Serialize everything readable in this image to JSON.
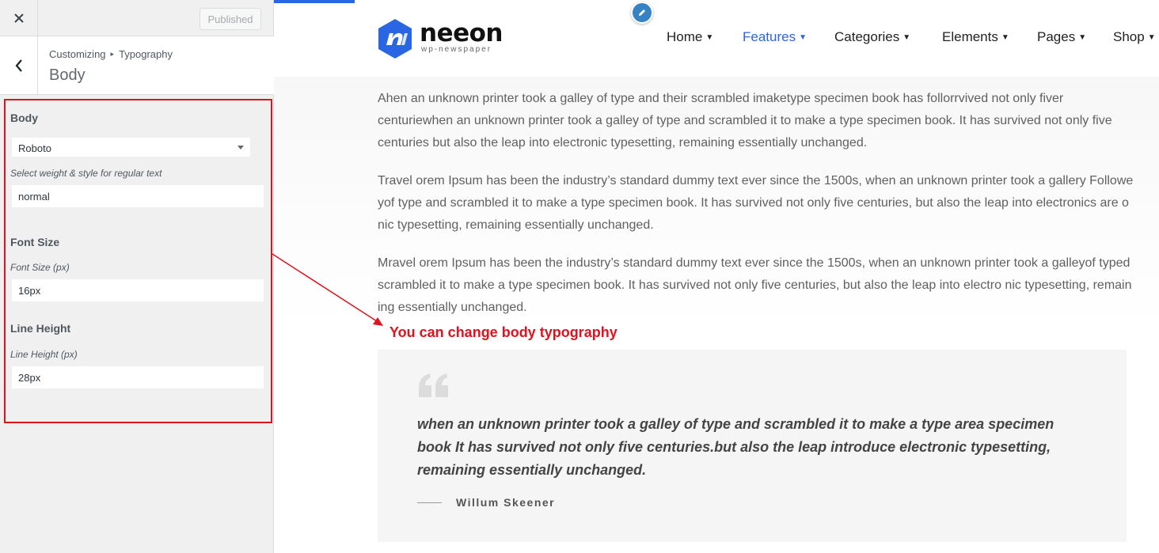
{
  "sidebar": {
    "close_label": "×",
    "published_label": "Published",
    "breadcrumb": {
      "root": "Customizing",
      "parent": "Typography"
    },
    "section_title": "Body",
    "controls": {
      "heading": "Body",
      "font_family": "Roboto",
      "weight_desc": "Select weight & style for regular text",
      "weight_value": "normal",
      "font_size_heading": "Font Size",
      "font_size_desc": "Font Size (px)",
      "font_size_value": "16px",
      "line_height_heading": "Line Height",
      "line_height_desc": "Line Height (px)",
      "line_height_value": "28px"
    }
  },
  "site": {
    "logo": {
      "name": "neeon",
      "tagline": "wp-newspaper"
    },
    "nav": [
      {
        "label": "Home"
      },
      {
        "label": "Features"
      },
      {
        "label": "Categories"
      },
      {
        "label": "Elements"
      },
      {
        "label": "Pages"
      },
      {
        "label": "Shop"
      }
    ],
    "active_nav": "Features",
    "paragraphs": [
      "Ahen an unknown printer took a galley of type and their scrambled imaketype specimen book has follorrvived not only fiver centuriewhen an unknown printer took a galley of type and scrambled it to make a type specimen book. It has survived not only five centuries but also the leap into electronic typesetting, remaining essentially unchanged.",
      "Travel orem Ipsum has been the industry’s standard dummy text ever since the 1500s, when an unknown printer took a gallery Followe yof type and scrambled it to make a type specimen book. It has survived not only five centuries, but also the leap into electronics are o nic typesetting, remaining essentially unchanged.",
      "Mravel orem Ipsum has been the industry’s standard dummy text ever since the 1500s, when an unknown printer took a galleyof typed scrambled it to make a type specimen book. It has survived not only five centuries, but also the leap into electro nic typesetting, remain ing essentially unchanged."
    ],
    "annotation": "You can change body typography",
    "quote": {
      "text": "when an unknown printer took a galley of type and scrambled it to make a type area specimen book It has survived not only five centuries.but also the leap introduce electronic typesetting, remaining essentially unchanged.",
      "author": "Willum Skeener"
    }
  },
  "colors": {
    "accent": "#2a66e3",
    "annotation_red": "#e0121b",
    "edit_pin": "#3582c4"
  }
}
